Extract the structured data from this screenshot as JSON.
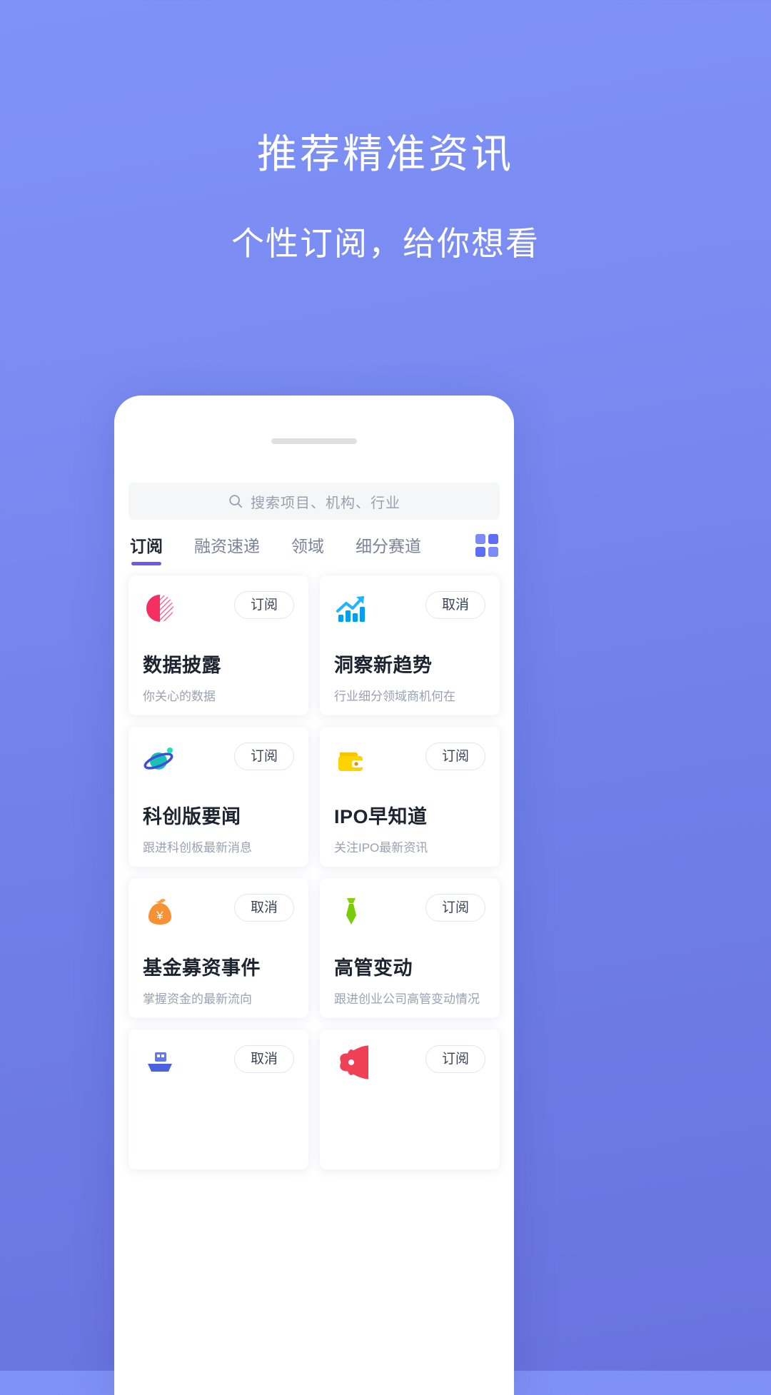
{
  "hero": {
    "title": "推荐精准资讯",
    "subtitle": "个性订阅，给你想看"
  },
  "colors": {
    "bg_top": "#7f93f7",
    "bg_bottom": "#6a72e0",
    "accent": "#6c5ce7",
    "grid_icon": "#5b6ef5"
  },
  "search": {
    "icon": "search-icon",
    "placeholder": "搜索项目、机构、行业",
    "value": ""
  },
  "tabs": [
    {
      "label": "订阅",
      "active": true
    },
    {
      "label": "融资速递",
      "active": false
    },
    {
      "label": "领域",
      "active": false
    },
    {
      "label": "细分赛道",
      "active": false
    }
  ],
  "grid_toggle": {
    "icon": "grid-view-icon"
  },
  "cards": [
    {
      "icon": "pie-chart-icon",
      "title": "数据披露",
      "subtitle": "你关心的数据",
      "action": "订阅"
    },
    {
      "icon": "bar-chart-up-icon",
      "title": "洞察新趋势",
      "subtitle": "行业细分领域商机何在",
      "action": "取消"
    },
    {
      "icon": "planet-icon",
      "title": "科创版要闻",
      "subtitle": "跟进科创板最新消息",
      "action": "订阅"
    },
    {
      "icon": "wallet-icon",
      "title": "IPO早知道",
      "subtitle": "关注IPO最新资讯",
      "action": "订阅"
    },
    {
      "icon": "money-bag-icon",
      "title": "基金募资事件",
      "subtitle": "掌握资金的最新流向",
      "action": "取消"
    },
    {
      "icon": "necktie-icon",
      "title": "高管变动",
      "subtitle": "跟进创业公司高管变动情况",
      "action": "订阅"
    },
    {
      "icon": "ship-icon",
      "title": "",
      "subtitle": "",
      "action": "取消"
    },
    {
      "icon": "aperture-icon",
      "title": "",
      "subtitle": "",
      "action": "订阅"
    }
  ]
}
